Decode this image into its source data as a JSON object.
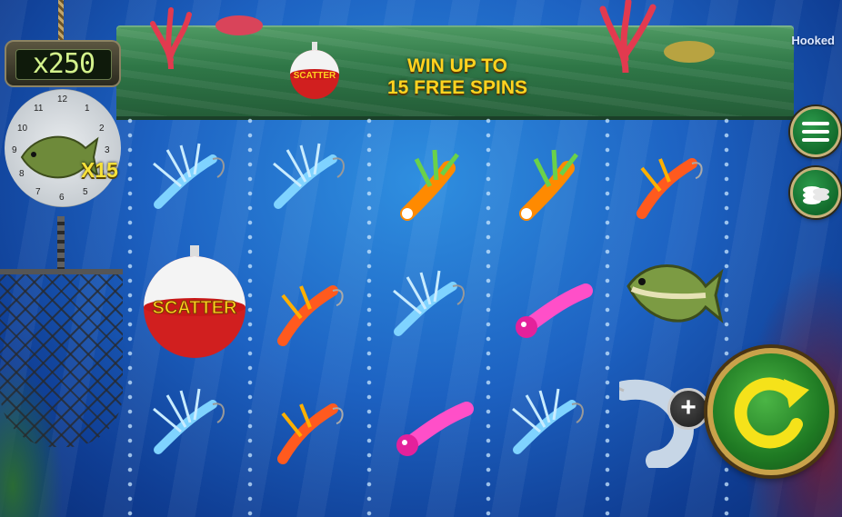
{
  "game": {
    "brand": "Hooked"
  },
  "banner": {
    "line1": "WIN UP TO",
    "line2": "15 FREE SPINS",
    "bobber_text": "SCATTER"
  },
  "scale": {
    "multiplier_display": "x250",
    "dial_numbers": [
      "12",
      "1",
      "2",
      "3",
      "4",
      "5",
      "6",
      "7",
      "8",
      "9",
      "10",
      "11"
    ]
  },
  "multiplier_badge": "X15",
  "reels": {
    "columns": 5,
    "rows": 3,
    "grid": [
      [
        "blue-fly",
        "blue-fly",
        "orange-fly",
        "orange-fly",
        "red-fly"
      ],
      [
        "scatter-bobber",
        "red-fly",
        "blue-fly",
        "pink-jig",
        "bass-fish"
      ],
      [
        "blue-fly",
        "red-fly",
        "pink-jig",
        "blue-fly",
        "marlin-fish"
      ]
    ],
    "scatter_text": "SCATTER"
  },
  "controls": {
    "menu_icon": "hamburger-menu-icon",
    "coins_icon": "coin-stack-icon",
    "spin_icon": "spin-arrow-icon",
    "plus_label": "+"
  },
  "colors": {
    "water": "#1d62c2",
    "banner_green": "#2f7747",
    "banner_text": "#ffd320",
    "spin_green": "#1f7a23",
    "gold_rim": "#c9a24a"
  }
}
